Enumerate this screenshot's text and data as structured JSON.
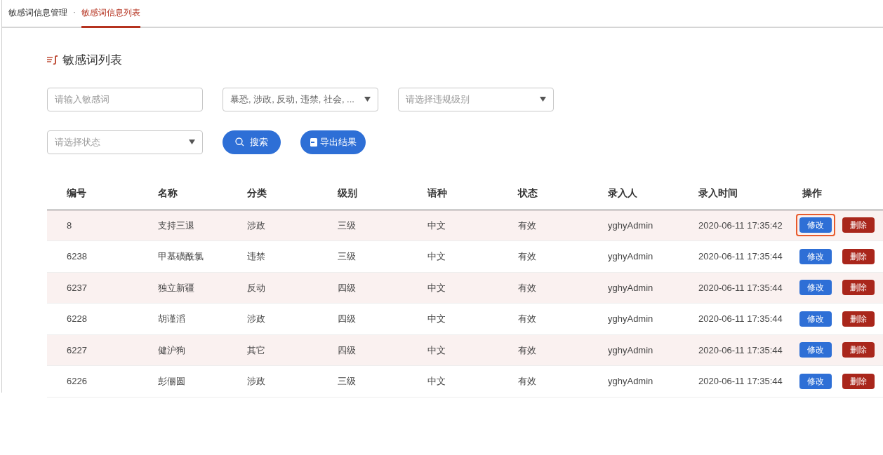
{
  "breadcrumb": [
    {
      "label": "敏感词信息管理",
      "selected": false
    },
    {
      "label": "敏感词信息列表",
      "selected": true
    }
  ],
  "breadcrumb_separator": "·",
  "title": "敏感词列表",
  "filters": {
    "keyword": {
      "placeholder": "请输入敏感词"
    },
    "category": {
      "value": "暴恐, 涉政, 反动, 违禁, 社会, ..."
    },
    "level": {
      "placeholder": "请选择违规级别"
    },
    "status": {
      "placeholder": "请选择状态"
    }
  },
  "buttons": {
    "search": "搜索",
    "export": "导出结果"
  },
  "table": {
    "columns": [
      "编号",
      "名称",
      "分类",
      "级别",
      "语种",
      "状态",
      "录入人",
      "录入时间",
      "操作"
    ],
    "rows": [
      {
        "cells": [
          "8",
          "支持三退",
          "涉政",
          "三级",
          "中文",
          "有效",
          "yghyAdmin",
          "2020-06-11 17:35:42"
        ],
        "edit": "修改",
        "delete": "删除",
        "focused": true
      },
      {
        "cells": [
          "6238",
          "甲基磺酰氯",
          "违禁",
          "三级",
          "中文",
          "有效",
          "yghyAdmin",
          "2020-06-11 17:35:44"
        ],
        "edit": "修改",
        "delete": "删除",
        "focused": false
      },
      {
        "cells": [
          "6237",
          "独立新疆",
          "反动",
          "四级",
          "中文",
          "有效",
          "yghyAdmin",
          "2020-06-11 17:35:44"
        ],
        "edit": "修改",
        "delete": "删除",
        "focused": false
      },
      {
        "cells": [
          "6228",
          "胡谨滔",
          "涉政",
          "四级",
          "中文",
          "有效",
          "yghyAdmin",
          "2020-06-11 17:35:44"
        ],
        "edit": "修改",
        "delete": "删除",
        "focused": false
      },
      {
        "cells": [
          "6227",
          "健沪狗",
          "其它",
          "四级",
          "中文",
          "有效",
          "yghyAdmin",
          "2020-06-11 17:35:44"
        ],
        "edit": "修改",
        "delete": "删除",
        "focused": false
      },
      {
        "cells": [
          "6226",
          "彭俪圆",
          "涉政",
          "三级",
          "中文",
          "有效",
          "yghyAdmin",
          "2020-06-11 17:35:44"
        ],
        "edit": "修改",
        "delete": "删除",
        "focused": false
      }
    ]
  }
}
